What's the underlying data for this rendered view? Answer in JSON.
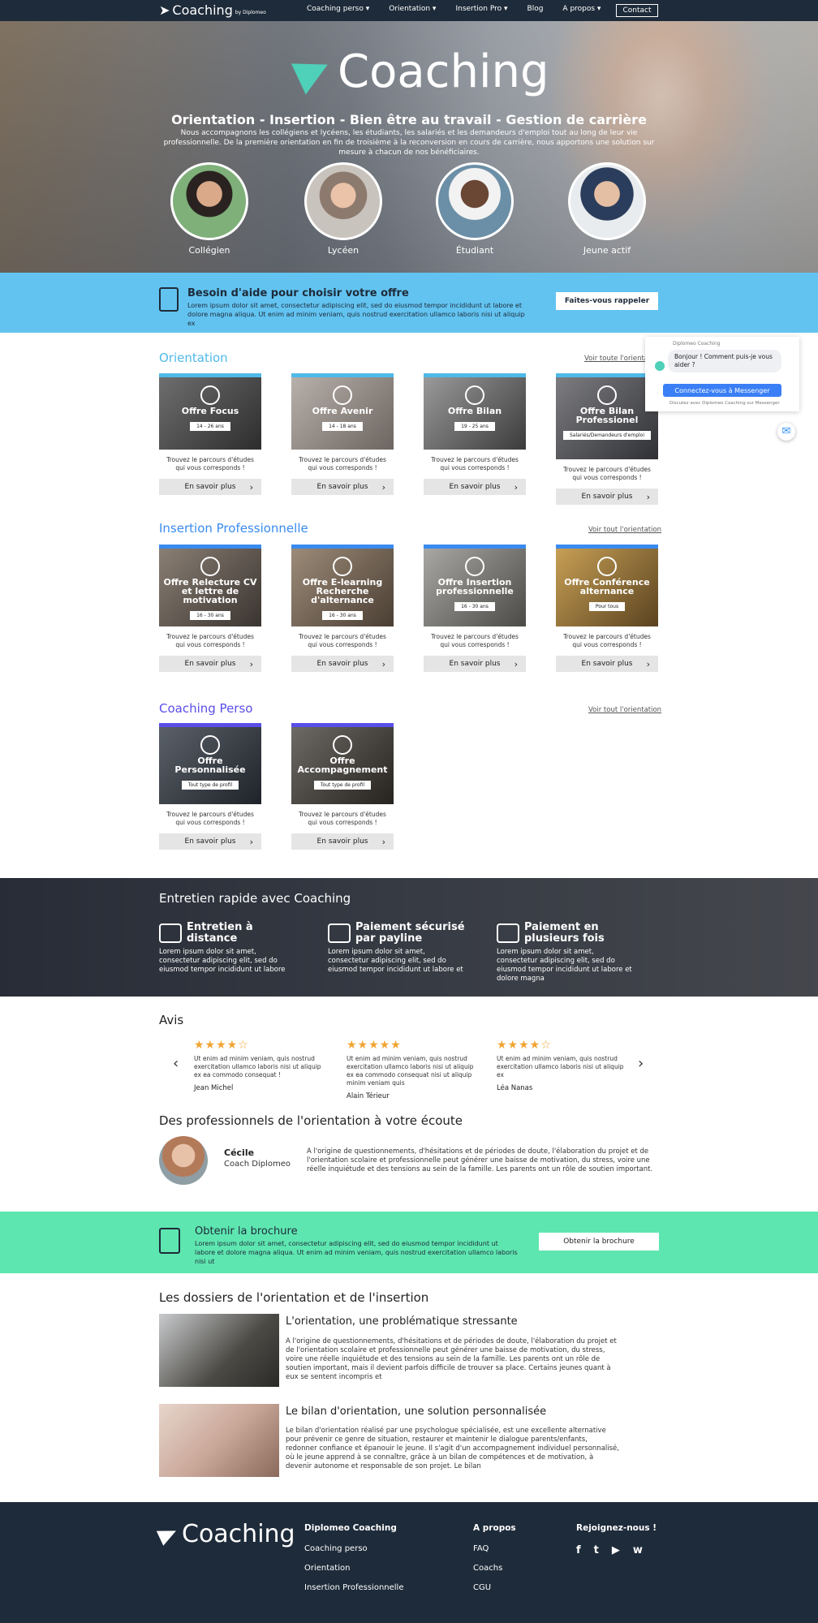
{
  "nav": {
    "logo": "Coaching",
    "logo_sub": "by Diplomeo",
    "menu": [
      "Coaching perso ▾",
      "Orientation ▾",
      "Insertion Pro ▾",
      "Blog",
      "A propos ▾"
    ],
    "contact": "Contact"
  },
  "hero": {
    "brand": "Coaching",
    "headline": "Orientation - Insertion - Bien être au travail - Gestion de carrière",
    "intro": "Nous accompagnons les collégiens et lycéens, les étudiants, les salariés et les demandeurs d'emploi tout au long de leur vie professionnelle. De la première orientation en fin de troisième à la reconversion en cours de carrière, nous apportons une solution sur mesure à chacun de nos bénéficiaires.",
    "personas": [
      "Collégien",
      "Lycéen",
      "Étudiant",
      "Jeune actif"
    ]
  },
  "callback": {
    "title": "Besoin d'aide pour choisir votre offre",
    "text": "Lorem ipsum dolor sit amet, consectetur adipiscing elit, sed do eiusmod tempor incididunt ut labore et dolore magna aliqua. Ut enim ad minim veniam, quis nostrud exercitation ullamco laboris nisi ut aliquip ex",
    "button": "Faites-vous rappeler"
  },
  "orientation": {
    "title": "Orientation",
    "link": "Voir toute l'orientation",
    "cards": [
      {
        "name": "Offre Focus",
        "age": "14 - 26 ans"
      },
      {
        "name": "Offre Avenir",
        "age": "14 - 18 ans"
      },
      {
        "name": "Offre Bilan",
        "age": "19 - 25 ans"
      },
      {
        "name": "Offre Bilan Professionel",
        "age": "Salariés/Demandeurs d'emploi"
      }
    ]
  },
  "insertion": {
    "title": "Insertion Professionnelle",
    "link": "Voir tout l'orientation",
    "cards": [
      {
        "name": "Offre Relecture CV et lettre de motivation",
        "age": "16 - 30 ans"
      },
      {
        "name": "Offre E-learning Recherche d'alternance",
        "age": "16 - 30 ans"
      },
      {
        "name": "Offre Insertion professionnelle",
        "age": "16 - 30 ans"
      },
      {
        "name": "Offre Conférence alternance",
        "age": "Pour tous"
      }
    ]
  },
  "perso": {
    "title": "Coaching Perso",
    "link": "Voir tout l'orientation",
    "cards": [
      {
        "name": "Offre Personnalisée",
        "age": "Tout type de profil"
      },
      {
        "name": "Offre Accompagnement",
        "age": "Tout type de profil"
      }
    ]
  },
  "card_desc": "Trouvez le parcours d'études qui vous corresponds !",
  "card_more": "En savoir plus",
  "chat": {
    "header": "Diplomeo Coaching",
    "message": "Bonjour ! Comment puis-je vous aider ?",
    "button": "Connectez-vous à Messenger",
    "footer": "Discutez avec Diplomeo Coaching sur Messenger"
  },
  "quick": {
    "title": "Entretien rapide avec Coaching",
    "features": [
      {
        "title": "Entretien à distance",
        "text": "Lorem ipsum dolor sit amet, consectetur adipiscing elit, sed do eiusmod tempor incididunt ut labore"
      },
      {
        "title": "Paiement sécurisé par payline",
        "text": "Lorem ipsum dolor sit amet, consectetur adipiscing elit, sed do eiusmod tempor incididunt ut labore et"
      },
      {
        "title": "Paiement en plusieurs fois",
        "text": "Lorem ipsum dolor sit amet, consectetur adipiscing elit, sed do eiusmod tempor incididunt ut labore et dolore magna"
      }
    ]
  },
  "avis": {
    "title": "Avis",
    "reviews": [
      {
        "stars": "★★★★☆",
        "text": "Ut enim ad minim veniam, quis nostrud exercitation ullamco laboris nisi ut aliquip ex ea commodo consequat !",
        "author": "Jean Michel"
      },
      {
        "stars": "★★★★★",
        "text": "Ut enim ad minim veniam, quis nostrud exercitation ullamco laboris nisi ut aliquip ex ea commodo consequat nisi ut aliquip minim veniam quis",
        "author": "Alain Térieur"
      },
      {
        "stars": "★★★★☆",
        "text": "Ut enim ad minim veniam, quis nostrud exercitation ullamco laboris nisi ut aliquip ex",
        "author": "Léa Nanas"
      }
    ]
  },
  "pros": {
    "title": "Des professionnels de l'orientation à votre écoute",
    "name": "Cécile",
    "role": "Coach Diplomeo",
    "text": "A l'origine de questionnements, d'hésitations et de périodes de doute, l'élaboration du projet et de l'orientation scolaire et professionnelle peut générer une baisse de motivation, du stress, voire une réelle inquiétude et des tensions au sein de la famille. Les parents ont un rôle de soutien important."
  },
  "brochure": {
    "title": "Obtenir la brochure",
    "text": "Lorem ipsum dolor sit amet, consectetur adipiscing elit, sed do eiusmod tempor incididunt ut labore et dolore magna aliqua. Ut enim ad minim veniam, quis nostrud exercitation ullamco laboris nisi ut",
    "button": "Obtenir la brochure"
  },
  "dossiers": {
    "title": "Les dossiers de l'orientation et de l'insertion",
    "articles": [
      {
        "title": "L'orientation, une problématique stressante",
        "text": "A l'origine de questionnements, d'hésitations et de périodes de doute, l'élaboration du projet et de l'orientation scolaire et professionnelle peut générer une baisse de motivation, du stress, voire une réelle inquiétude et des tensions au sein de la famille. Les parents ont un rôle de soutien important, mais il devient parfois difficile de trouver sa place. Certains jeunes quant à eux se sentent incompris et"
      },
      {
        "title": "Le bilan d'orientation, une solution personnalisée",
        "text": "Le bilan d'orientation réalisé par une psychologue spécialisée, est une excellente alternative pour prévenir ce genre de situation, restaurer et maintenir le dialogue parents/enfants, redonner confiance et épanouir le jeune. Il s'agit d'un accompagnement individuel personnalisé, où le jeune apprend à se connaître, grâce à un bilan de compétences et de motivation, à devenir autonome et responsable de son projet. Le bilan"
      }
    ]
  },
  "footer": {
    "logo": "Coaching",
    "col1": {
      "title": "Diplomeo Coaching",
      "links": [
        "Coaching perso",
        "Orientation",
        "Insertion Professionnelle"
      ]
    },
    "col2": {
      "title": "A propos",
      "links": [
        "FAQ",
        "Coachs",
        "CGU"
      ]
    },
    "col3": {
      "title": "Rejoignez-nous !",
      "icons": [
        "f",
        "t",
        "▶",
        "w"
      ]
    }
  },
  "colors": {
    "navy": "#1e2b3a",
    "blue_band": "#62c3f0",
    "green_band": "#5ee6b0",
    "orientation_accent": "#4fb9e8",
    "insertion_accent": "#3a8bf0",
    "perso_accent": "#5a4ee8",
    "stars": "#f0a431"
  }
}
